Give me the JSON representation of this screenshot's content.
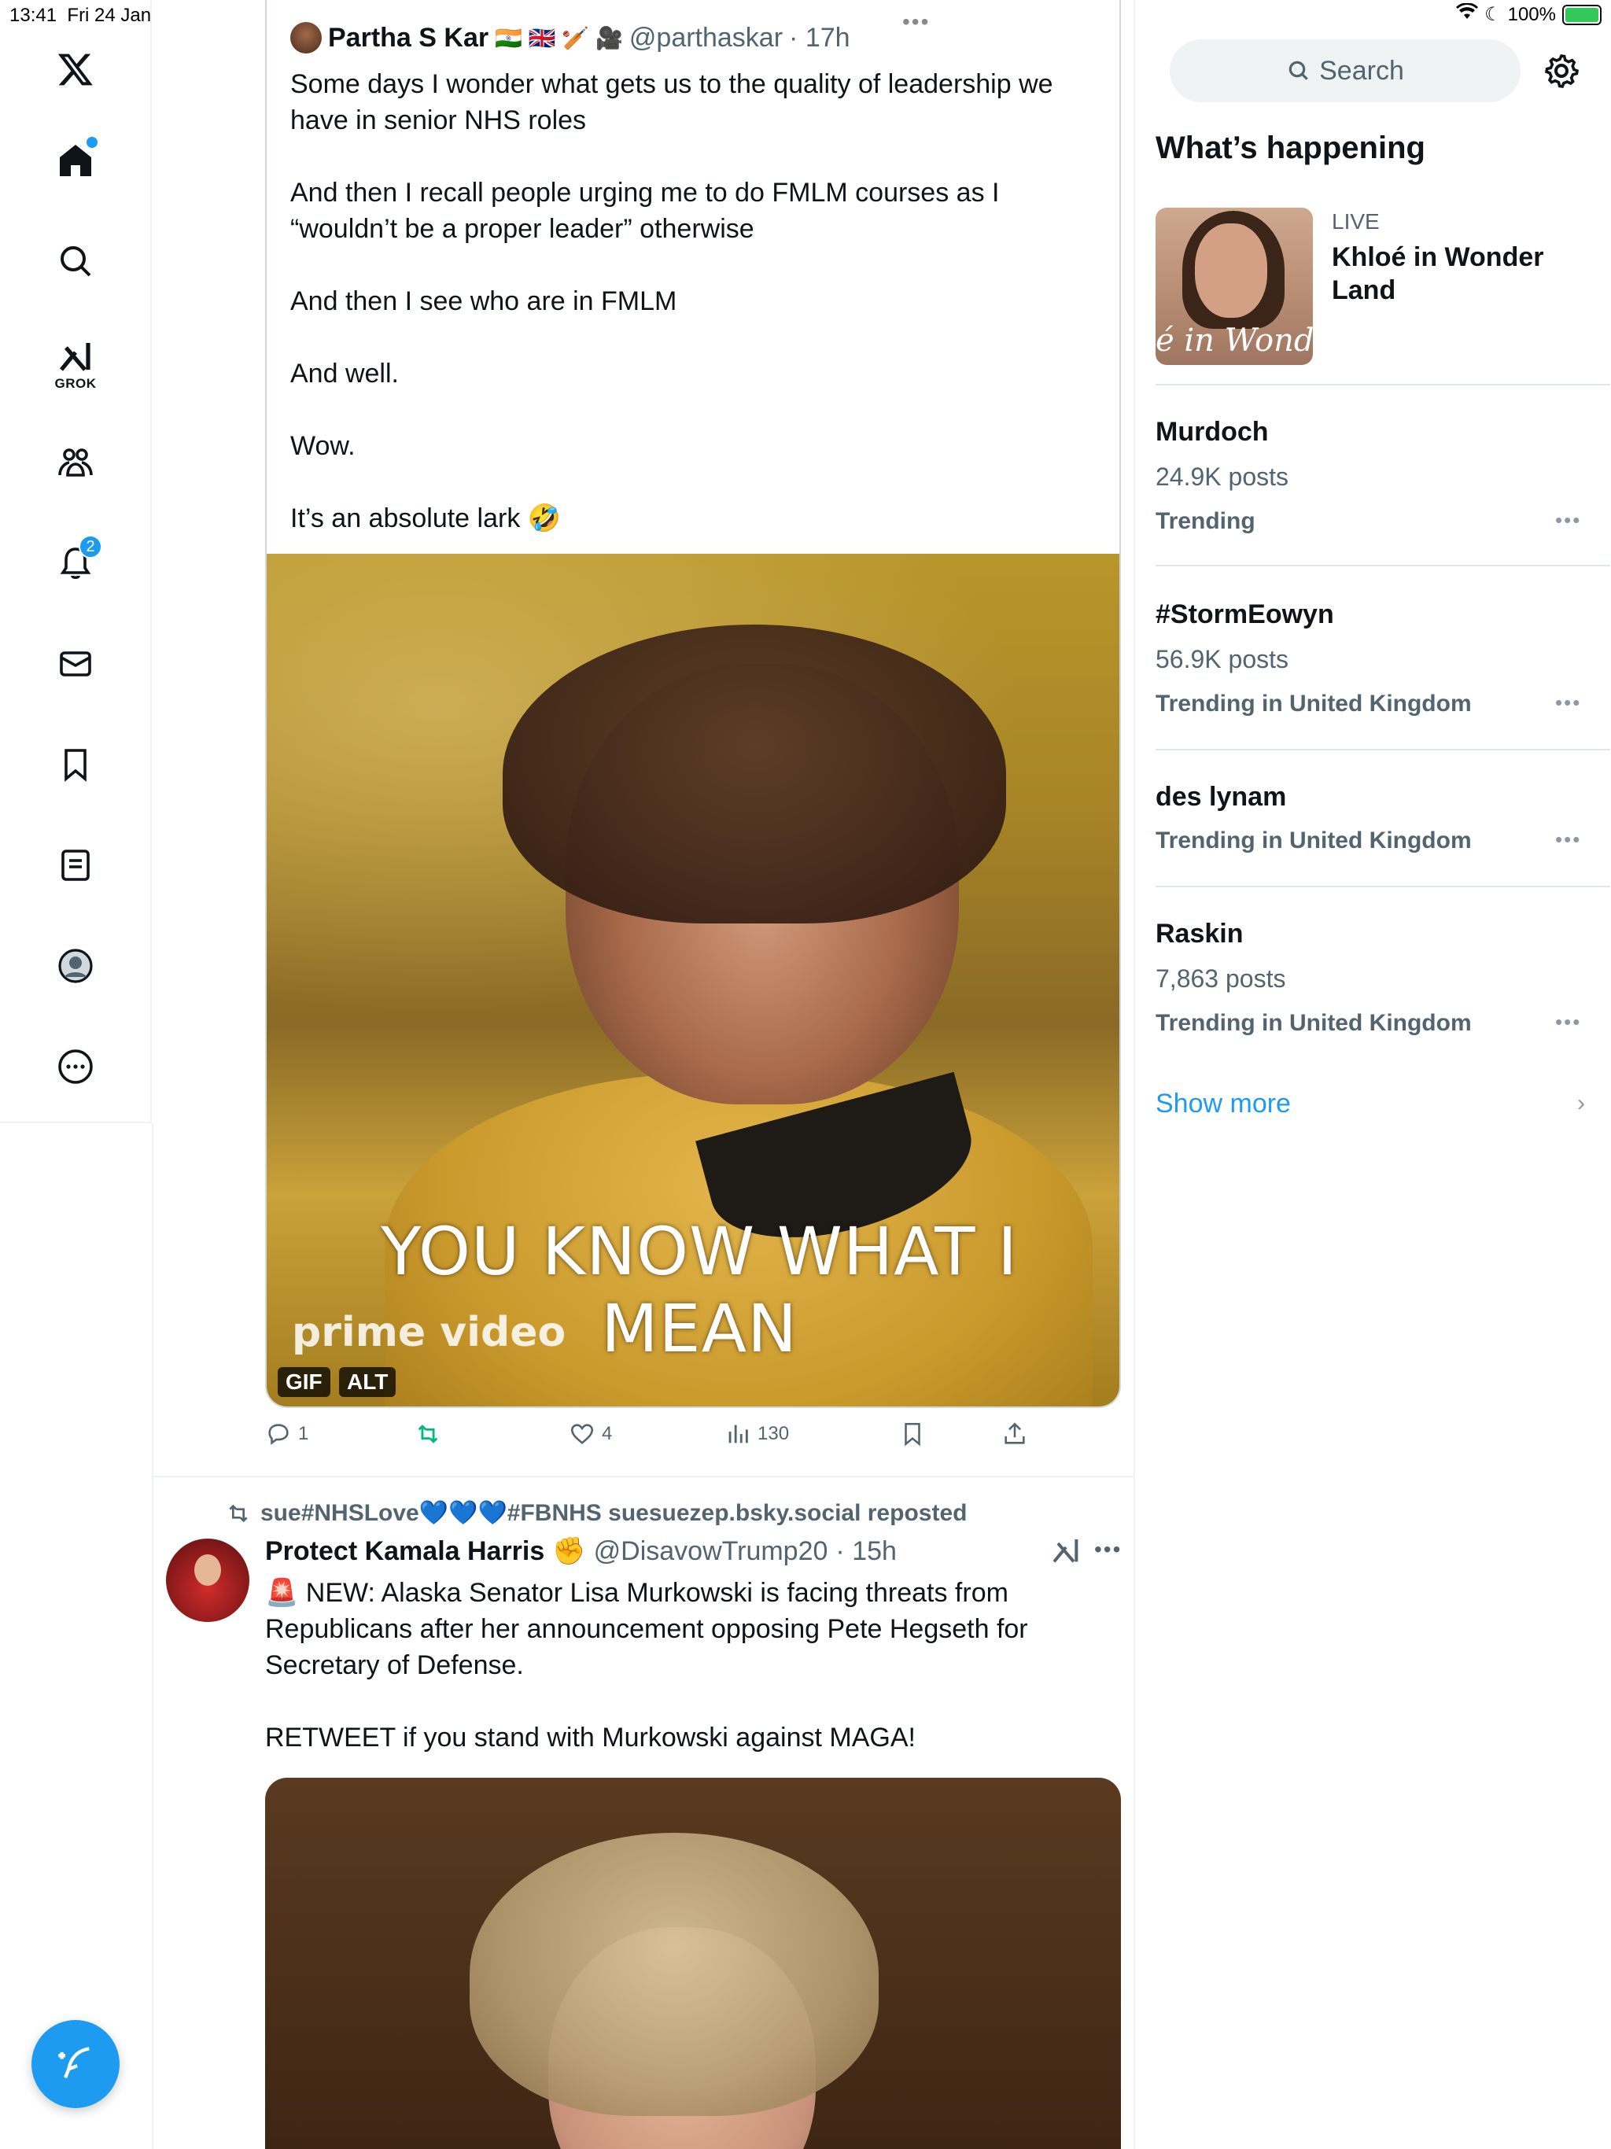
{
  "status": {
    "time": "13:41",
    "date": "Fri 24 Jan",
    "battery": "100%"
  },
  "nav": {
    "grok_label": "GROK",
    "notifications_badge": "2"
  },
  "quote": {
    "name": "Partha S Kar",
    "flags": "🇮🇳 🇬🇧 🏏 🎥",
    "handle": "@parthaskar",
    "time": "· 17h",
    "paragraphs": [
      "Some days I wonder what gets us to the quality of leadership we have in senior NHS roles",
      "And then I recall people urging me to do FMLM courses as I “wouldn’t be a proper leader” otherwise",
      "And then I see who are in FMLM",
      "And well.",
      "Wow.",
      "It’s an absolute lark 🤣"
    ],
    "gif_caption": "YOU KNOW WHAT I MEAN",
    "gif_brand": "prime video",
    "gif_tag": "GIF",
    "alt_tag": "ALT"
  },
  "actions": {
    "replies": "1",
    "likes": "4",
    "views": "130"
  },
  "tweet": {
    "reposted_by": "sue#NHSLove💙💙💙#FBNHS suesuezep.bsky.social reposted",
    "name": "Protect Kamala Harris",
    "name_emoji": "✊",
    "handle": "@DisavowTrump20",
    "time": "· 15h",
    "paragraphs": [
      "🚨 NEW: Alaska Senator Lisa Murkowski is facing threats from Republicans after her announcement opposing Pete Hegseth for Secretary of Defense.",
      "RETWEET if you stand with Murkowski against MAGA!"
    ]
  },
  "sidebar": {
    "search_placeholder": "Search",
    "whats_happening": "What’s happening",
    "live_label": "LIVE",
    "live_title": "Khloé in Wonder Land",
    "live_thumb_text": "é in Wonder L",
    "trends": [
      {
        "title": "Murdoch",
        "count": "24.9K posts",
        "meta": "Trending"
      },
      {
        "title": "#StormEowyn",
        "count": "56.9K posts",
        "meta": "Trending in United Kingdom"
      },
      {
        "title": "des lynam",
        "count": "",
        "meta": "Trending in United Kingdom"
      },
      {
        "title": "Raskin",
        "count": "7,863 posts",
        "meta": "Trending in United Kingdom"
      }
    ],
    "show_more": "Show more"
  },
  "colors": {
    "accent": "#1d9bf0",
    "repost_green": "#00ba7c",
    "muted": "#536471"
  },
  "icons": [
    "x-logo-icon",
    "home-icon",
    "search-icon",
    "grok-icon",
    "communities-icon",
    "bell-icon",
    "mail-icon",
    "bookmark-icon",
    "lists-icon",
    "profile-icon",
    "more-icon",
    "compose-icon",
    "reply-icon",
    "repost-icon",
    "like-icon",
    "views-icon",
    "share-icon",
    "gear-icon"
  ]
}
